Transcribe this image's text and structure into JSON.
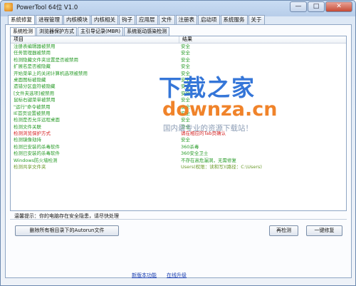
{
  "window": {
    "title": "PowerTool 64位 V1.0",
    "minimize_glyph": "—",
    "maximize_glyph": "□",
    "close_glyph": "✕"
  },
  "main_tabs": [
    {
      "label": "系统修复",
      "active": true
    },
    {
      "label": "进程管理",
      "active": false
    },
    {
      "label": "内核模块",
      "active": false
    },
    {
      "label": "内核相关",
      "active": false
    },
    {
      "label": "钩子",
      "active": false
    },
    {
      "label": "应用层",
      "active": false
    },
    {
      "label": "文件",
      "active": false
    },
    {
      "label": "注册表",
      "active": false
    },
    {
      "label": "启动项",
      "active": false
    },
    {
      "label": "系统服务",
      "active": false
    },
    {
      "label": "关于",
      "active": false
    }
  ],
  "sub_tabs": [
    {
      "label": "系统检测",
      "active": true
    },
    {
      "label": "浏览器保护方式",
      "active": false
    },
    {
      "label": "主引导记录(MBR)",
      "active": false
    },
    {
      "label": "系统驱动感染检测",
      "active": false
    }
  ],
  "list": {
    "columns": {
      "item": "项目",
      "result": "结果"
    },
    "rows": [
      {
        "item": "注册表编辑器被禁用",
        "result": "安全",
        "color": "#2a9c2a"
      },
      {
        "item": "任务管理器被禁用",
        "result": "安全",
        "color": "#2a9c2a"
      },
      {
        "item": "检测隐藏文件夹设置是否被禁用",
        "result": "安全",
        "color": "#2a9c2a"
      },
      {
        "item": "扩展名是否被隐藏",
        "result": "安全",
        "color": "#2a9c2a"
      },
      {
        "item": "开始菜单上的关闭计算机选项被禁用",
        "result": "安全",
        "color": "#2a9c2a"
      },
      {
        "item": "桌面图标被隐藏",
        "result": "安全",
        "color": "#2a9c2a"
      },
      {
        "item": "遗错分区盘符被隐藏",
        "result": "安全",
        "color": "#2a9c2a"
      },
      {
        "item": "[文件夹选项]被禁用",
        "result": "安全",
        "color": "#2a9c2a"
      },
      {
        "item": "鼠标右键菜单被禁用",
        "result": "安全",
        "color": "#2a9c2a"
      },
      {
        "item": "\"运行\"命令被禁用",
        "result": "安全",
        "color": "#2a9c2a"
      },
      {
        "item": "IE首页设置被禁用",
        "result": "安全",
        "color": "#2a9c2a"
      },
      {
        "item": "检测是否允许远程桌面",
        "result": "安全",
        "color": "#2a9c2a"
      },
      {
        "item": "检测文件关联",
        "result": "安全",
        "color": "#2a9c2a"
      },
      {
        "item": "检测浏览保护方式",
        "result": "请在相应的Tab页确认",
        "color": "#d42020"
      },
      {
        "item": "检测镜像劫持",
        "result": "安全",
        "color": "#2a9c2a"
      },
      {
        "item": "检测已安装的杀毒软件",
        "result": "360杀毒",
        "color": "#2a9c2a"
      },
      {
        "item": "检测已安装的杀毒软件",
        "result": "360安全卫士",
        "color": "#2a9c2a"
      },
      {
        "item": "Windows防火墙检测",
        "result": "不存在高危漏洞，无需修复",
        "color": "#2a9c2a"
      },
      {
        "item": "检测共享文件夹",
        "result": "Users(权限：读和写)(路径：C:\\Users)",
        "color": "#6a9a2a"
      }
    ]
  },
  "status_message": "温馨提示：你的电脑存在安全隐患，请尽快处理",
  "buttons": {
    "delete_autorun": "删除所有根目录下的Autorun文件",
    "recheck": "再检测",
    "one_click_fix": "一键修复"
  },
  "links": {
    "new_features": "新版本功能",
    "online_upgrade": "在线升级"
  },
  "watermark": {
    "logo": "下载之家",
    "url": "downza.cn",
    "slogan": "国内最专业的资源下载站！"
  }
}
